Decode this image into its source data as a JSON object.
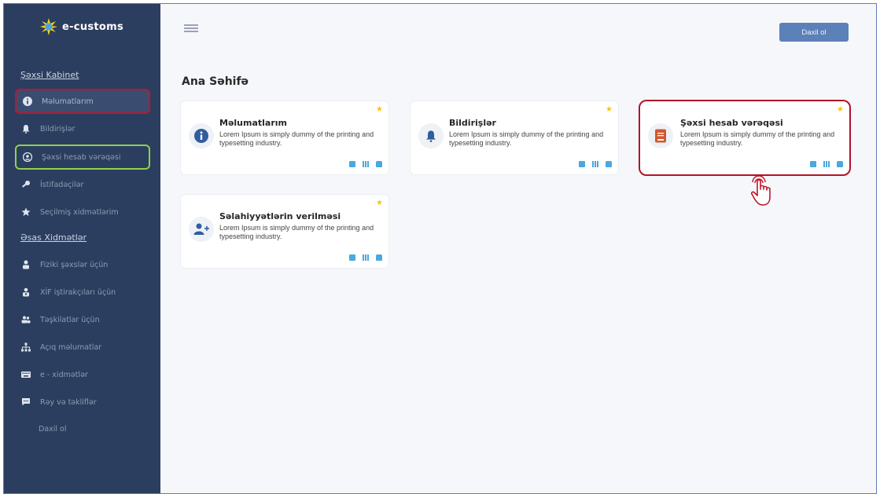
{
  "app": {
    "brand": "e-customs"
  },
  "colors": {
    "sidebar": "#2c3e5f",
    "accent": "#5c80b8",
    "star": "#f5c518",
    "highlight_red": "#c0162a",
    "highlight_green": "#8fd14f",
    "action_blue": "#4aa8e0"
  },
  "sidebar": {
    "section1": "Şəxsi Kabinet",
    "section2": "Əsas Xidmətlər",
    "items": [
      {
        "label": "Məlumatlarım",
        "icon": "info-icon"
      },
      {
        "label": "Bildirişlər",
        "icon": "bell-icon"
      },
      {
        "label": "Şəxsi hesab vərəqəsi",
        "icon": "user-circle-icon"
      },
      {
        "label": "İstifadəçilər",
        "icon": "key-icon"
      },
      {
        "label": "Seçilmiş xidmətlərim",
        "icon": "star-icon"
      },
      {
        "label": "Fiziki şəxslər üçün",
        "icon": "person-icon"
      },
      {
        "label": "XİF iştirakçıları üçün",
        "icon": "person-badge-icon"
      },
      {
        "label": "Təşkilatlar üçün",
        "icon": "group-icon"
      },
      {
        "label": "Açıq məlumatlar",
        "icon": "sitemap-icon"
      },
      {
        "label": "e - xidmətlər",
        "icon": "keyboard-icon"
      },
      {
        "label": "Rəy və təkliflər",
        "icon": "comment-icon"
      }
    ],
    "login": "Daxil ol"
  },
  "header": {
    "login_button": "Daxil ol",
    "menu_icon": "hamburger-icon"
  },
  "main": {
    "title": "Ana Səhifə",
    "cards": [
      {
        "title": "Məlumatlarım",
        "desc": "Lorem Ipsum is simply dummy of the printing and typesetting industry.",
        "icon": "info-icon"
      },
      {
        "title": "Bildirişlər",
        "desc": "Lorem Ipsum is simply dummy of the printing and typesetting industry.",
        "icon": "bell-icon"
      },
      {
        "title": "Şəxsi hesab vərəqəsi",
        "desc": "Lorem Ipsum is simply dummy of the printing and typesetting industry.",
        "icon": "book-icon"
      },
      {
        "title": "Səlahiyyətlərin verilməsi",
        "desc": "Lorem Ipsum is simply dummy of the printing and typesetting industry.",
        "icon": "user-plus-icon"
      }
    ]
  }
}
